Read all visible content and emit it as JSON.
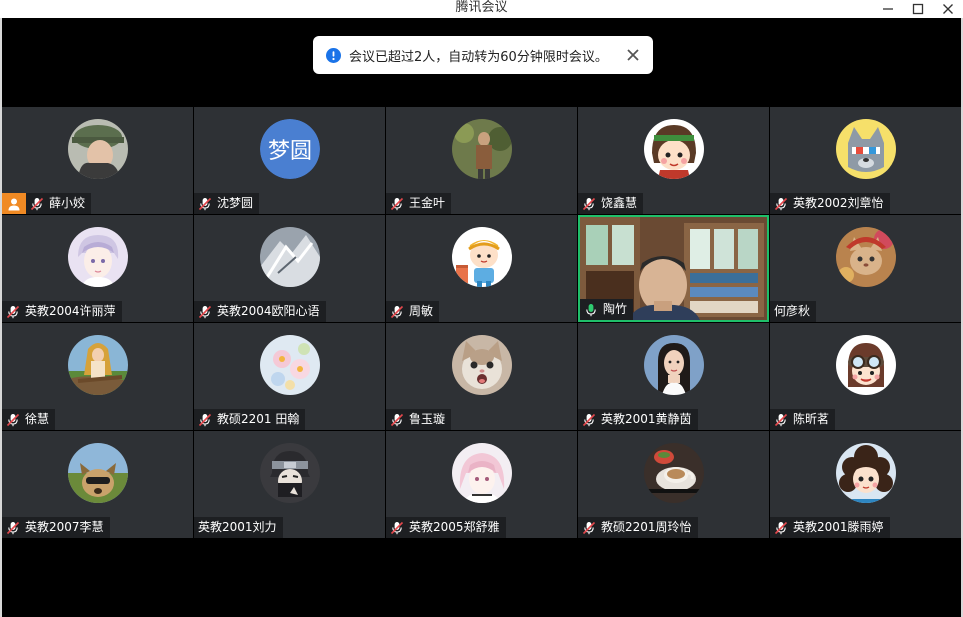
{
  "window": {
    "title": "腾讯会议"
  },
  "toast": {
    "message": "会议已超过2人，自动转为60分钟限时会议。"
  },
  "participants": [
    {
      "name": "薛小姣",
      "muted": true,
      "host": true,
      "avatar": "photo-cap"
    },
    {
      "name": "沈梦圆",
      "muted": true,
      "avatar_text": "梦圆"
    },
    {
      "name": "王金叶",
      "muted": true,
      "avatar": "photo-outdoor"
    },
    {
      "name": "饶鑫慧",
      "muted": true,
      "avatar": "cartoon-girl"
    },
    {
      "name": "英教2002刘章怡",
      "muted": true,
      "avatar": "cartoon-dog"
    },
    {
      "name": "英教2004许丽萍",
      "muted": true,
      "avatar": "anime-boy"
    },
    {
      "name": "英教2004欧阳心语",
      "muted": true,
      "avatar": "anime-grey"
    },
    {
      "name": "周敏",
      "muted": true,
      "avatar": "cartoon-kid"
    },
    {
      "name": "陶竹",
      "muted": false,
      "speaking": true,
      "avatar": "video"
    },
    {
      "name": "何彦秋",
      "muted": null,
      "avatar": "photo-cat-hat"
    },
    {
      "name": "徐慧",
      "muted": true,
      "avatar": "photo-girl-outdoor"
    },
    {
      "name": "教硕2201 田翰",
      "muted": true,
      "avatar": "photo-flowers"
    },
    {
      "name": "鲁玉璇",
      "muted": true,
      "avatar": "photo-cat"
    },
    {
      "name": "英教2001黄静茵",
      "muted": true,
      "avatar": "photo-woman"
    },
    {
      "name": "陈昕茗",
      "muted": true,
      "avatar": "cartoon-goggles"
    },
    {
      "name": "英教2007李慧",
      "muted": true,
      "avatar": "photo-dog"
    },
    {
      "name": "英教2001刘力",
      "muted": null,
      "avatar": "anime-ninja"
    },
    {
      "name": "英教2005郑舒雅",
      "muted": true,
      "avatar": "anime-pink"
    },
    {
      "name": "教硕2201周玲怡",
      "muted": true,
      "avatar": "photo-coffee"
    },
    {
      "name": "英教2001滕雨婷",
      "muted": true,
      "avatar": "cartoon-curly"
    }
  ],
  "colors": {
    "tile_bg": "#2e3135",
    "active_border": "#1fbf6a",
    "host_badge": "#f08a24",
    "avatar_text_bg": "#4a7fd1",
    "toast_icon": "#1a73e8"
  }
}
